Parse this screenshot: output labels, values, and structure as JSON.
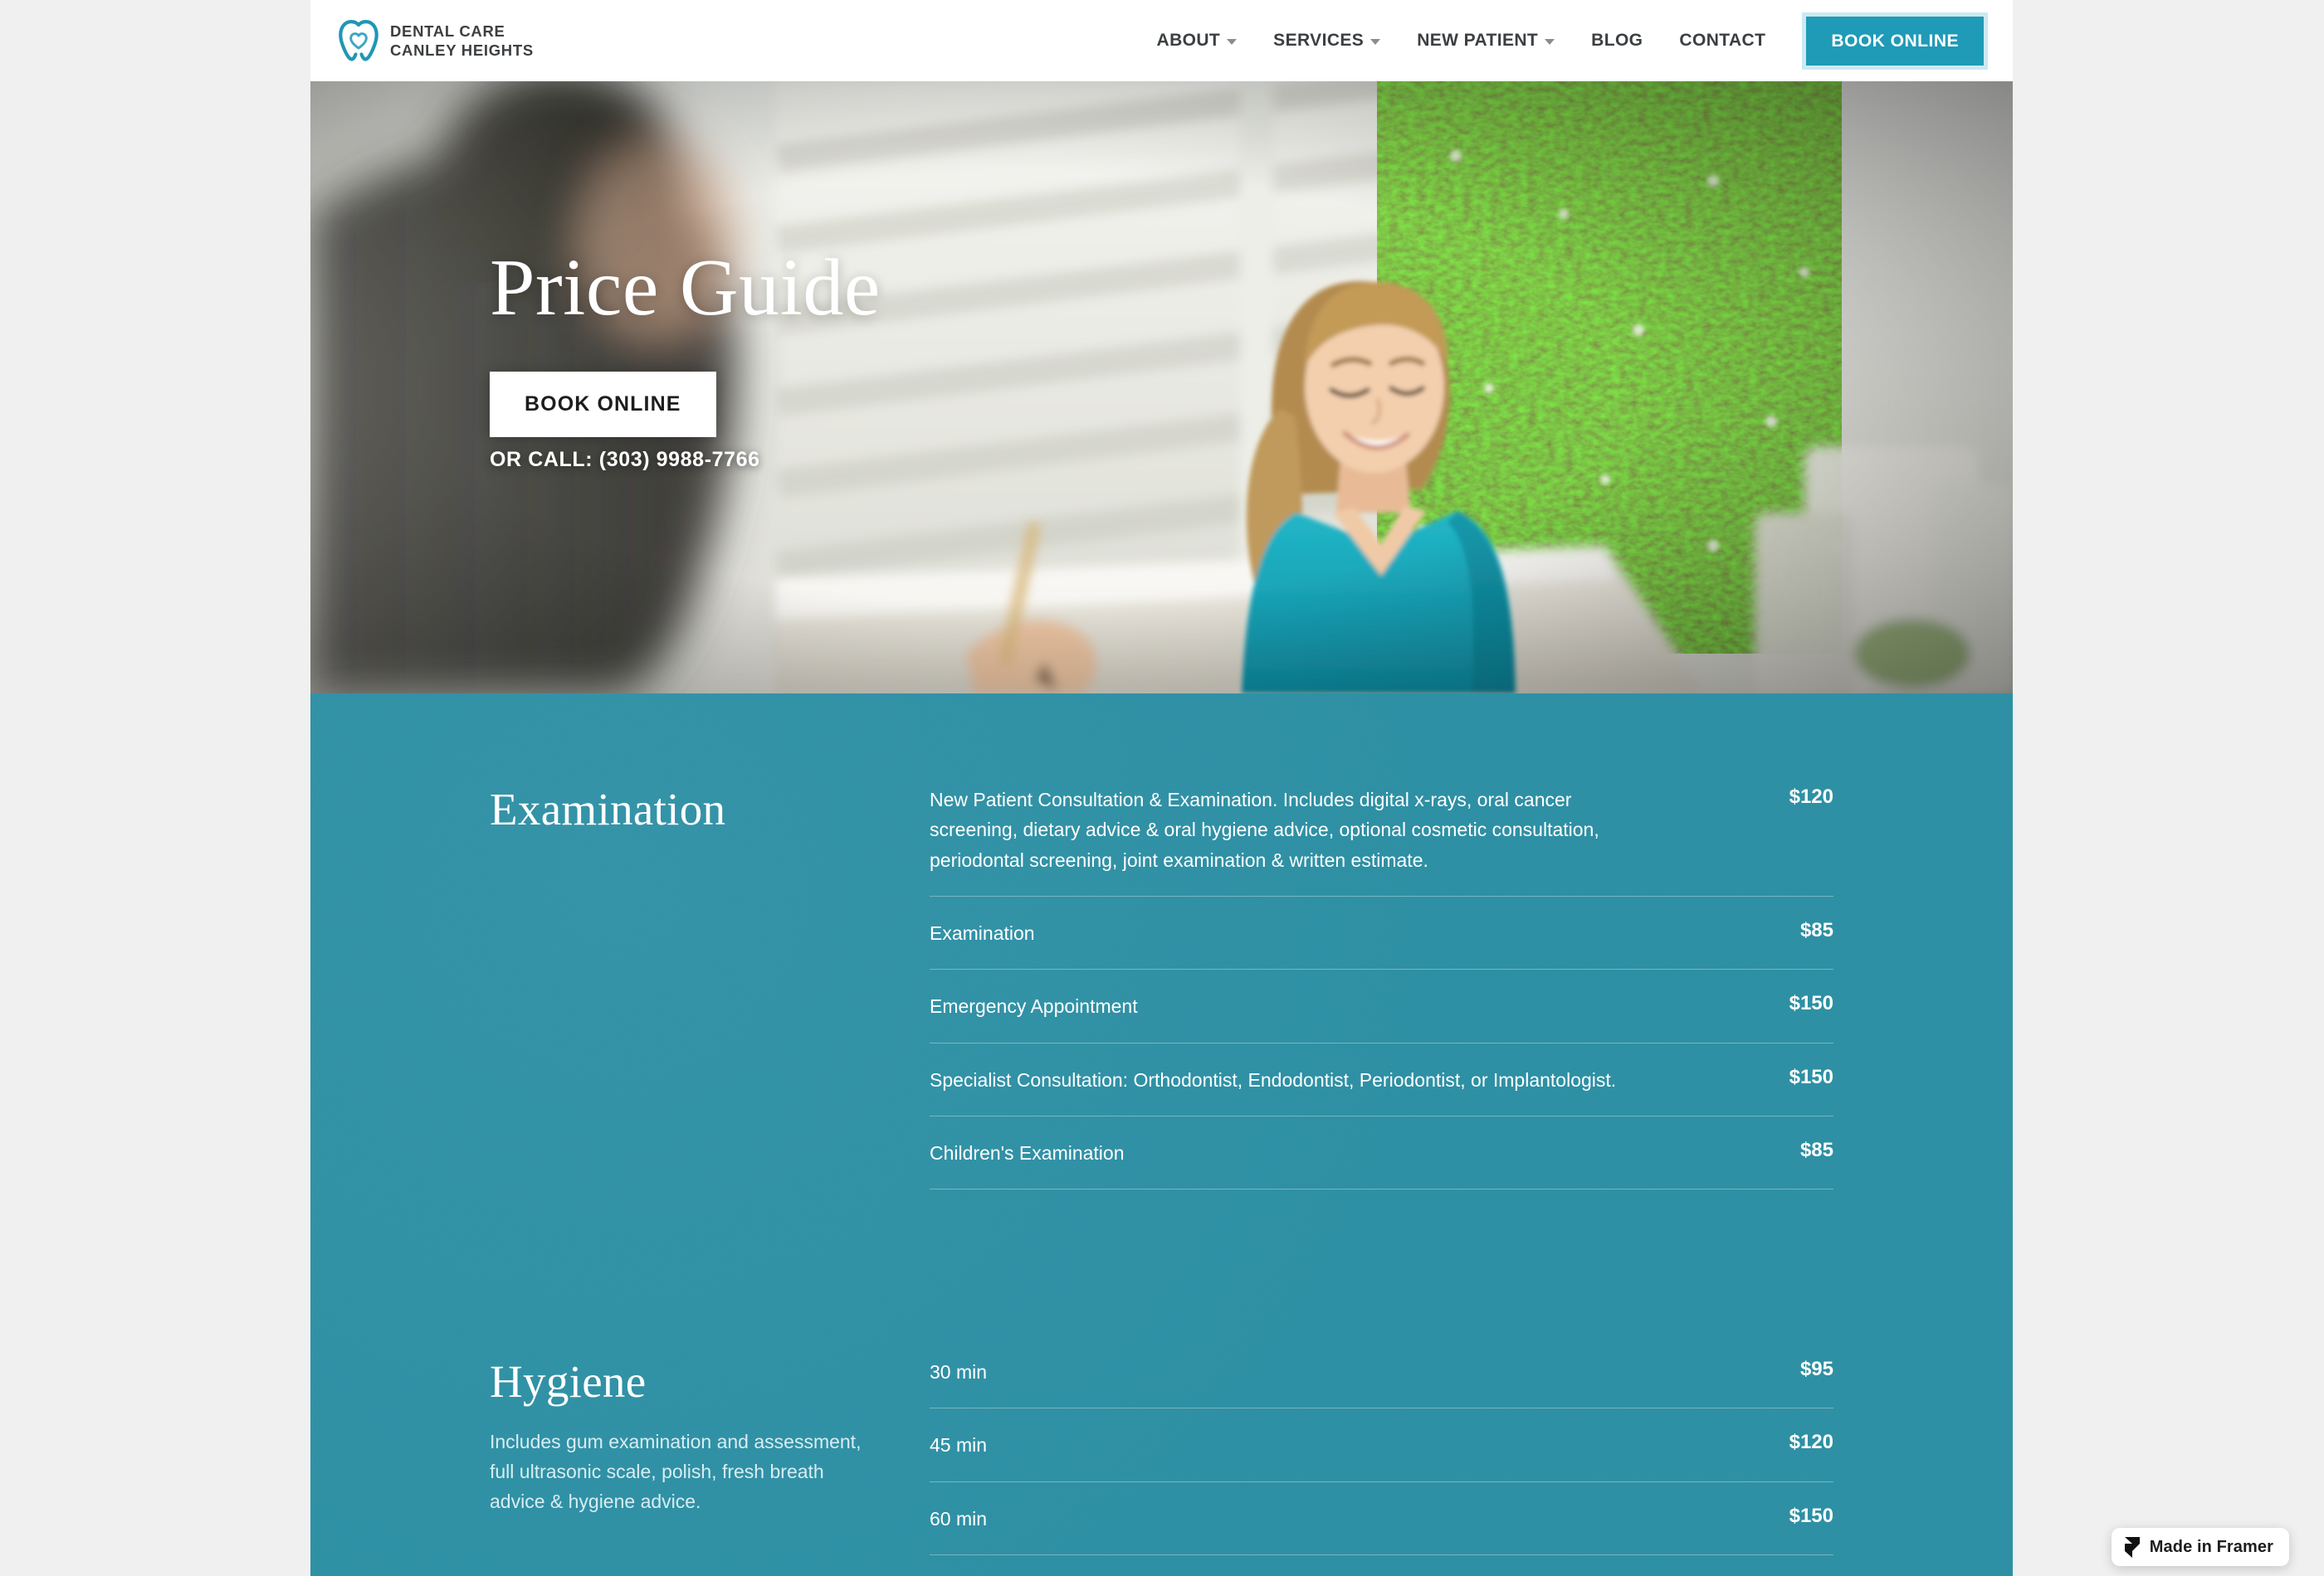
{
  "site": {
    "background_outer": "#f0f0f0",
    "brand_teal": "#2b8fa4",
    "cta_teal": "#1f9ab7"
  },
  "header": {
    "logo_icon": "tooth-heart-logo-icon",
    "brand_line1": "DENTAL CARE",
    "brand_line2": "CANLEY HEIGHTS",
    "nav_items": [
      {
        "label": "ABOUT",
        "has_dropdown": true
      },
      {
        "label": "SERVICES",
        "has_dropdown": true
      },
      {
        "label": "NEW PATIENT",
        "has_dropdown": true
      },
      {
        "label": "BLOG",
        "has_dropdown": false
      },
      {
        "label": "CONTACT",
        "has_dropdown": false
      }
    ],
    "cta_label": "BOOK ONLINE"
  },
  "hero": {
    "title": "Price Guide",
    "button_label": "BOOK ONLINE",
    "phone_text": "OR CALL: (303) 9988-7766",
    "image_description": "dental-reception-photo"
  },
  "pricing": {
    "sections": [
      {
        "heading": "Examination",
        "subtitle": "",
        "rows": [
          {
            "label": "New Patient Consultation & Examination. Includes digital x-rays, oral cancer screening, dietary advice & oral hygiene advice, optional cosmetic consultation, periodontal screening, joint examination & written estimate.",
            "price": "$120"
          },
          {
            "label": "Examination",
            "price": "$85"
          },
          {
            "label": "Emergency Appointment",
            "price": "$150"
          },
          {
            "label": "Specialist Consultation: Orthodontist, Endodontist, Periodontist, or Implantologist.",
            "price": "$150"
          },
          {
            "label": "Children's Examination",
            "price": "$85"
          }
        ]
      },
      {
        "heading": "Hygiene",
        "subtitle": "Includes gum examination and assessment, full ultrasonic scale, polish, fresh breath advice & hygiene advice.",
        "rows": [
          {
            "label": "30 min",
            "price": "$95"
          },
          {
            "label": "45 min",
            "price": "$120"
          },
          {
            "label": "60 min",
            "price": "$150"
          }
        ]
      }
    ]
  },
  "framer_badge": {
    "label": "Made in Framer",
    "icon": "framer-logo-icon"
  }
}
